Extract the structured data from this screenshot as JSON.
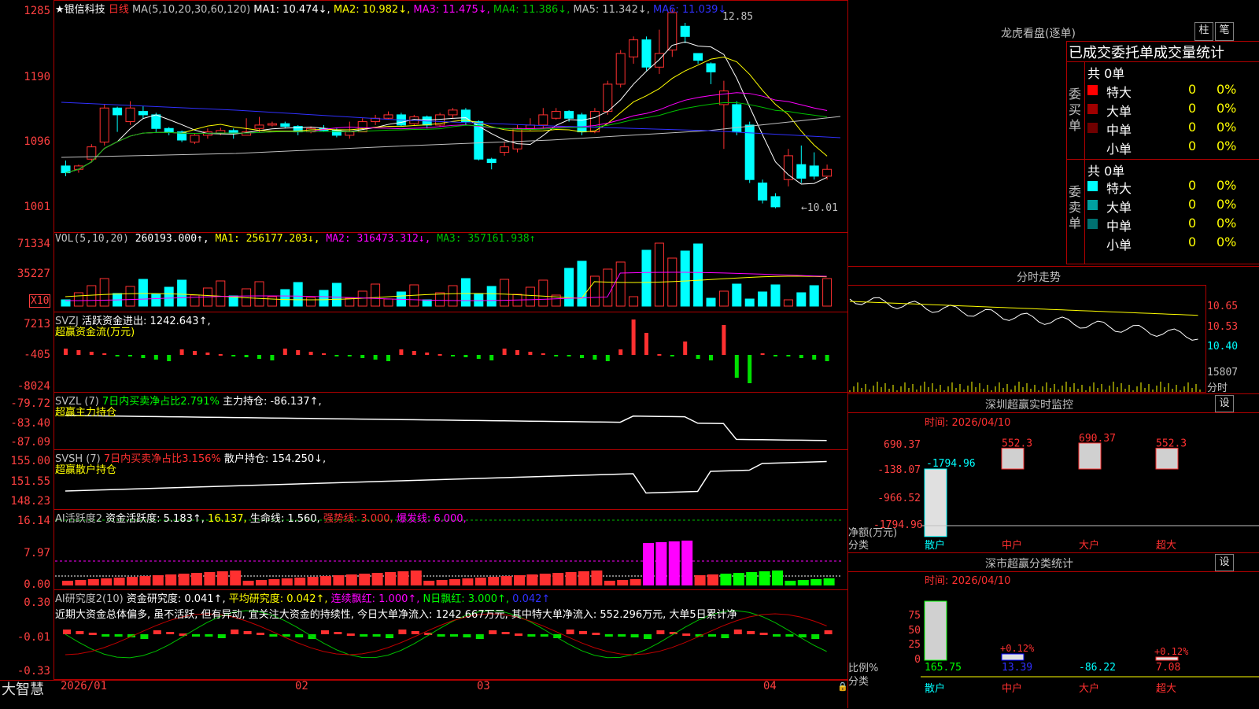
{
  "colors": {
    "up": "#ff3030",
    "down": "#00ffff",
    "grid": "#b00000",
    "axis": "#ff4040",
    "ma1": "#ffffff",
    "ma2": "#ffff00",
    "ma3": "#ff00ff",
    "ma4": "#00c000",
    "ma5": "#c0c0c0",
    "ma6": "#3030ff"
  },
  "main": {
    "star": "★",
    "stock_name": "银信科技",
    "period": "日线",
    "ma_label": "MA(5,10,20,30,60,120)",
    "ma1": "MA1: 10.474↓,",
    "ma2": "MA2: 10.982↓,",
    "ma3": "MA3: 11.475↓,",
    "ma4": "MA4: 11.386↓,",
    "ma5": "MA5: 11.342↓,",
    "ma6": "MA6: 11.039↓",
    "y_ticks": [
      "1285",
      "1190",
      "1096",
      "1001"
    ],
    "high_label": "12.85",
    "low_label": "←10.01"
  },
  "vol": {
    "label": "VOL(5,10,20)",
    "value": "260193.000↑,",
    "ma1": "MA1: 256177.203↓,",
    "ma2": "MA2: 316473.312↓,",
    "ma3": "MA3: 357161.938↑",
    "y_ticks": [
      "71334",
      "35227"
    ],
    "unit": "X10"
  },
  "svzj": {
    "label": "SVZJ",
    "text": "活跃资金进出: 1242.643↑,",
    "sub": "超赢资金流(万元)",
    "y_ticks": [
      "7213",
      "-405",
      "-8024"
    ]
  },
  "svzl": {
    "label": "SVZL (7)",
    "ratio": "7日内买卖净占比2.791%",
    "text": "主力持仓: -86.137↑,",
    "sub": "超赢主力持仓",
    "y_ticks": [
      "-79.72",
      "-83.40",
      "-87.09"
    ]
  },
  "svsh": {
    "label": "SVSH (7)",
    "ratio": "7日内买卖净占比3.156%",
    "text": "散户持仓: 154.250↓,",
    "sub": "超赢散户持仓",
    "y_ticks": [
      "155.00",
      "151.55",
      "148.23"
    ]
  },
  "ai1": {
    "label": "AI活跃度2",
    "text1": "资金活跃度: 5.183↑,",
    "text2": "16.137,",
    "text3": "生命线: 1.560,",
    "text4": "强势线: 3.000,",
    "text5": "爆发线: 6.000,",
    "y_ticks": [
      "16.14",
      "7.97",
      "0.00"
    ]
  },
  "ai2": {
    "label": "AI研究度2(10)",
    "text1": "资金研究度: 0.041↑,",
    "text2": "平均研究度: 0.042↑,",
    "text3": "连续飘红: 1.000↑,",
    "text4": "N日飘红: 3.000↑,",
    "text5": "0.042↑",
    "comment": "近期大资金总体偏多, 虽不活跃, 但有异动, 宜关注大资金的持续性, 今日大单净流入: 1242.667万元, 其中特大单净流入: 552.296万元, 大单5日累计净",
    "y_ticks": [
      "0.30",
      "-0.01",
      "-0.33"
    ]
  },
  "xaxis": {
    "labels": [
      "2026/01",
      "02",
      "03",
      "04"
    ]
  },
  "footer": {
    "brand": "大智慧"
  },
  "right": {
    "lhb_title": "龙虎看盘(逐单)",
    "btn_zhu": "柱",
    "btn_bi": "笔",
    "stats_title": "已成交委托单成交量统计",
    "buy_side": "委买单",
    "sell_side": "委卖单",
    "buy_total": "共 0单",
    "sell_total": "共 0单",
    "buy_rows": [
      {
        "label": "特大",
        "count": "0",
        "pct": "0%",
        "color": "#ff0000"
      },
      {
        "label": "大单",
        "count": "0",
        "pct": "0%",
        "color": "#a00000"
      },
      {
        "label": "中单",
        "count": "0",
        "pct": "0%",
        "color": "#700000"
      },
      {
        "label": "小单",
        "count": "0",
        "pct": "0%",
        "color": "#000000"
      }
    ],
    "sell_rows": [
      {
        "label": "特大",
        "count": "0",
        "pct": "0%",
        "color": "#00ffff"
      },
      {
        "label": "大单",
        "count": "0",
        "pct": "0%",
        "color": "#00a0a0"
      },
      {
        "label": "中单",
        "count": "0",
        "pct": "0%",
        "color": "#007070"
      },
      {
        "label": "小单",
        "count": "0",
        "pct": "0%",
        "color": "#000000"
      }
    ],
    "intraday_title": "分时走势",
    "intraday_ticks": [
      "10.65",
      "10.53",
      "10.40",
      "15807"
    ],
    "intraday_unit": "分时",
    "monitor_title": "深圳超赢实时监控",
    "settings": "设",
    "monitor_time": "时间: 2026/04/10",
    "monitor_y": [
      "690.37",
      "-138.07",
      "-966.52",
      "-1794.96"
    ],
    "monitor_bars": [
      {
        "cat": "散户",
        "value": -1794.96,
        "label": "-1794.96"
      },
      {
        "cat": "中户",
        "value": 552.3,
        "label": "552.3"
      },
      {
        "cat": "大户",
        "value": 690.37,
        "label": "690.37"
      },
      {
        "cat": "超大",
        "value": 552.3,
        "label": "552.3"
      }
    ],
    "monitor_ylabel1": "净额(万元)",
    "monitor_ylabel2": "分类",
    "class_title": "深市超赢分类统计",
    "class_time": "时间: 2026/04/10",
    "class_y": [
      "75",
      "50",
      "25",
      "0"
    ],
    "class_bars": [
      {
        "cat": "散户",
        "value": "165.75",
        "pct": 75,
        "ann": ""
      },
      {
        "cat": "中户",
        "value": "13.39",
        "pct": 8,
        "ann": "+0.12%"
      },
      {
        "cat": "大户",
        "value": "-86.22",
        "pct": 0,
        "ann": ""
      },
      {
        "cat": "超大",
        "value": "7.08",
        "pct": 4,
        "ann": "+0.12%"
      }
    ],
    "class_ylabel1": "比例%",
    "class_ylabel2": "分类"
  },
  "chart_data": [
    {
      "type": "candlestick",
      "title": "日线",
      "candles": [
        [
          10.6,
          10.5,
          10.68,
          10.45
        ],
        [
          10.55,
          10.6,
          10.62,
          10.5
        ],
        [
          10.7,
          10.88,
          10.92,
          10.65
        ],
        [
          10.95,
          11.45,
          11.5,
          10.9
        ],
        [
          11.45,
          11.35,
          11.47,
          11.1
        ],
        [
          11.25,
          11.45,
          11.55,
          11.2
        ],
        [
          11.4,
          11.35,
          11.48,
          11.3
        ],
        [
          11.35,
          11.15,
          11.38,
          11.1
        ],
        [
          11.15,
          11.1,
          11.17,
          11.05
        ],
        [
          11.1,
          10.98,
          11.12,
          10.95
        ],
        [
          10.95,
          11.05,
          11.08,
          10.92
        ],
        [
          11.05,
          11.1,
          11.15,
          11.0
        ],
        [
          11.08,
          11.12,
          11.16,
          11.05
        ],
        [
          11.12,
          11.08,
          11.15,
          11.0
        ],
        [
          11.05,
          11.1,
          11.3,
          11.05
        ],
        [
          11.15,
          11.2,
          11.32,
          11.1
        ],
        [
          11.2,
          11.22,
          11.25,
          11.18
        ],
        [
          11.22,
          11.18,
          11.25,
          11.15
        ],
        [
          11.18,
          11.1,
          11.2,
          11.05
        ],
        [
          11.1,
          11.15,
          11.18,
          11.08
        ],
        [
          11.15,
          11.12,
          11.2,
          11.1
        ],
        [
          11.12,
          11.05,
          11.15,
          11.02
        ],
        [
          11.05,
          11.1,
          11.25,
          11.0
        ],
        [
          11.1,
          11.25,
          11.3,
          11.1
        ],
        [
          11.25,
          11.3,
          11.35,
          11.2
        ],
        [
          11.3,
          11.35,
          11.4,
          11.28
        ],
        [
          11.35,
          11.2,
          11.38,
          11.18
        ],
        [
          11.22,
          11.32,
          11.35,
          11.2
        ],
        [
          11.32,
          11.2,
          11.34,
          11.15
        ],
        [
          11.2,
          11.35,
          11.38,
          11.18
        ],
        [
          11.35,
          11.42,
          11.45,
          11.3
        ],
        [
          11.42,
          11.25,
          11.45,
          11.2
        ],
        [
          11.25,
          10.7,
          11.27,
          10.68
        ],
        [
          10.7,
          10.65,
          10.72,
          10.55
        ],
        [
          10.8,
          10.88,
          10.95,
          10.75
        ],
        [
          10.85,
          11.15,
          11.2,
          10.8
        ],
        [
          11.15,
          11.2,
          11.3,
          11.12
        ],
        [
          11.2,
          11.35,
          11.45,
          11.15
        ],
        [
          11.3,
          11.4,
          11.45,
          11.28
        ],
        [
          11.4,
          11.3,
          11.42,
          11.25
        ],
        [
          11.35,
          11.1,
          11.38,
          11.05
        ],
        [
          11.1,
          11.4,
          11.45,
          11.08
        ],
        [
          11.4,
          11.8,
          11.85,
          11.35
        ],
        [
          11.8,
          12.25,
          12.3,
          11.75
        ],
        [
          12.2,
          12.45,
          12.5,
          12.1
        ],
        [
          12.45,
          12.05,
          12.5,
          12.0
        ],
        [
          12.05,
          12.25,
          12.6,
          11.95
        ],
        [
          12.3,
          12.85,
          12.9,
          12.2
        ],
        [
          12.65,
          12.5,
          12.7,
          12.4
        ],
        [
          12.25,
          12.15,
          12.2,
          12.1
        ],
        [
          12.1,
          11.98,
          12.12,
          11.8
        ],
        [
          11.5,
          11.7,
          11.85,
          10.85
        ],
        [
          11.5,
          11.1,
          11.55,
          11.05
        ],
        [
          11.2,
          10.4,
          11.25,
          10.35
        ],
        [
          10.35,
          10.1,
          10.4,
          10.05
        ],
        [
          10.15,
          10.0,
          10.2,
          9.98
        ],
        [
          10.4,
          10.75,
          10.85,
          10.3
        ],
        [
          10.62,
          10.42,
          10.9,
          10.35
        ],
        [
          10.6,
          10.45,
          10.8,
          10.4
        ],
        [
          10.45,
          10.55,
          10.62,
          10.4
        ]
      ],
      "ylim": [
        10.01,
        12.85
      ]
    }
  ]
}
